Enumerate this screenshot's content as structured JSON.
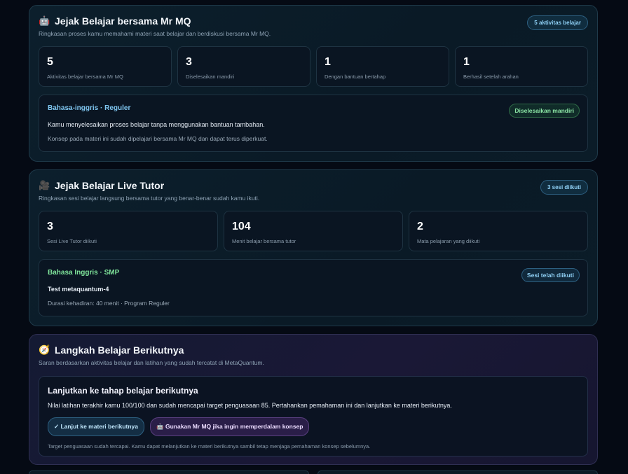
{
  "mrmq": {
    "icon": "robot-icon",
    "title": "Jejak Belajar bersama Mr MQ",
    "subtitle": "Ringkasan proses kamu memahami materi saat belajar dan berdiskusi bersama Mr MQ.",
    "pill": "5 aktivitas belajar",
    "stats": [
      {
        "num": "5",
        "label": "Aktivitas belajar bersama Mr MQ"
      },
      {
        "num": "3",
        "label": "Diselesaikan mandiri"
      },
      {
        "num": "1",
        "label": "Dengan bantuan bertahap"
      },
      {
        "num": "1",
        "label": "Berhasil setelah arahan"
      }
    ],
    "card": {
      "tag": "Bahasa-inggris · Reguler",
      "badge": "Diselesaikan mandiri",
      "text": "Kamu menyelesaikan proses belajar tanpa menggunakan bantuan tambahan.",
      "muted": "Konsep pada materi ini sudah dipelajari bersama Mr MQ dan dapat terus diperkuat."
    }
  },
  "tutor": {
    "icon": "film-camera-icon",
    "title": "Jejak Belajar Live Tutor",
    "subtitle": "Ringkasan sesi belajar langsung bersama tutor yang benar-benar sudah kamu ikuti.",
    "pill": "3 sesi diikuti",
    "stats": [
      {
        "num": "3",
        "label": "Sesi Live Tutor diikuti"
      },
      {
        "num": "104",
        "label": "Menit belajar bersama tutor"
      },
      {
        "num": "2",
        "label": "Mata pelajaran yang diikuti"
      }
    ],
    "card": {
      "tag": "Bahasa Inggris · SMP",
      "badge": "Sesi telah diikuti",
      "text": "Test metaquantum-4",
      "muted": "Durasi kehadiran: 40 menit · Program Reguler"
    }
  },
  "next": {
    "icon": "compass-icon",
    "title": "Langkah Belajar Berikutnya",
    "subtitle": "Saran berdasarkan aktivitas belajar dan latihan yang sudah tercatat di MetaQuantum.",
    "card_title": "Lanjutkan ke tahap belajar berikutnya",
    "card_text": "Nilai latihan terakhir kamu 100/100 dan sudah mencapai target penguasaan 85. Pertahankan pemahaman ini dan lanjutkan ke materi berikutnya.",
    "btn_next": "✓ Lanjut ke materi berikutnya",
    "btn_mq": "🤖 Gunakan Mr MQ jika ingin memperdalam konsep",
    "note": "Target penguasaan sudah tercapai. Kamu dapat melanjutkan ke materi berikutnya sambil tetap menjaga pemahaman konsep sebelumnya."
  }
}
